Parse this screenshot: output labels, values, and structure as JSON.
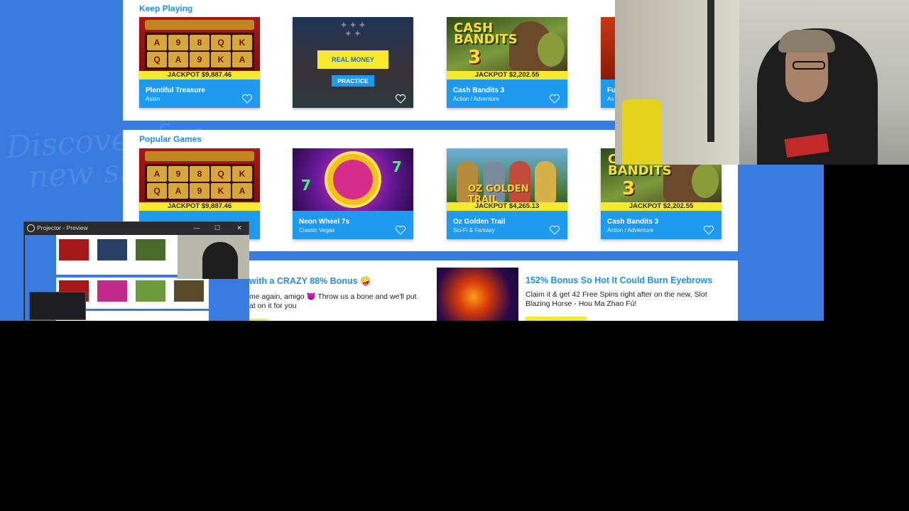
{
  "keep_playing": {
    "title": "Keep Playing",
    "cards": [
      {
        "name": "Plentiful Treasure",
        "category": "Asian",
        "jackpot": "JACKPOT $9,887.46"
      },
      {
        "name": "",
        "category": "",
        "jackpot": "",
        "overlay": {
          "real_money": "REAL MONEY",
          "practice": "PRACTICE"
        }
      },
      {
        "name": "Cash Bandits 3",
        "category": "Action / Adventure",
        "jackpot": "JACKPOT $2,202.55"
      },
      {
        "name": "Fu",
        "category": "As"
      }
    ]
  },
  "popular_games": {
    "title": "Popular Games",
    "cards": [
      {
        "name": "",
        "category": "",
        "jackpot": "JACKPOT $9,887.46"
      },
      {
        "name": "Neon Wheel 7s",
        "category": "Classic Vegas"
      },
      {
        "name": "Oz Golden Trail",
        "category": "Sci-Fi & Fantasy",
        "jackpot": "JACKPOT $4,265.13"
      },
      {
        "name": "Cash Bandits 3",
        "category": "Action / Adventure",
        "jackpot": "JACKPOT $2,202.55"
      }
    ]
  },
  "promos": [
    {
      "title": "with a CRAZY 88% Bonus 🤪",
      "text": "me again, amigo 😈 Throw us a bone and we'll put\nat on it for you"
    },
    {
      "title": "152% Bonus So Hot It Could Burn Eyebrows",
      "text": "Claim it & get 42 Free Spins right after on the new, Slot\nBlazing Horse - Hou Ma Zhao Fú!"
    }
  ],
  "projector": {
    "title": "Projector - Preview",
    "controls": {
      "minimize": "—",
      "maximize": "☐",
      "close": "✕"
    }
  },
  "icons": [
    "heart-icon",
    "obs-icon"
  ],
  "colors": {
    "accent_blue": "#1e9bf0",
    "jackpot_yellow": "#f7e92b",
    "background_blue": "#3a7be0"
  }
}
